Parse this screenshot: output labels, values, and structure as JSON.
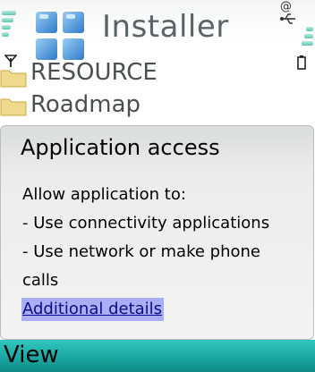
{
  "status": {
    "at_symbol": "@"
  },
  "header": {
    "title": "Installer"
  },
  "list": {
    "items": [
      "RESOURCE",
      "Roadmap"
    ]
  },
  "dialog": {
    "title": "Application access",
    "lines": [
      "Allow application to:",
      "- Use connectivity applications",
      "- Use network or make phone",
      "calls"
    ],
    "link": "Additional details"
  },
  "softkeys": {
    "left": "View"
  },
  "colors": {
    "softkey_bar": "#1ba8a2",
    "link_highlight": "#a9aef5",
    "title_gray": "#5a6468"
  }
}
